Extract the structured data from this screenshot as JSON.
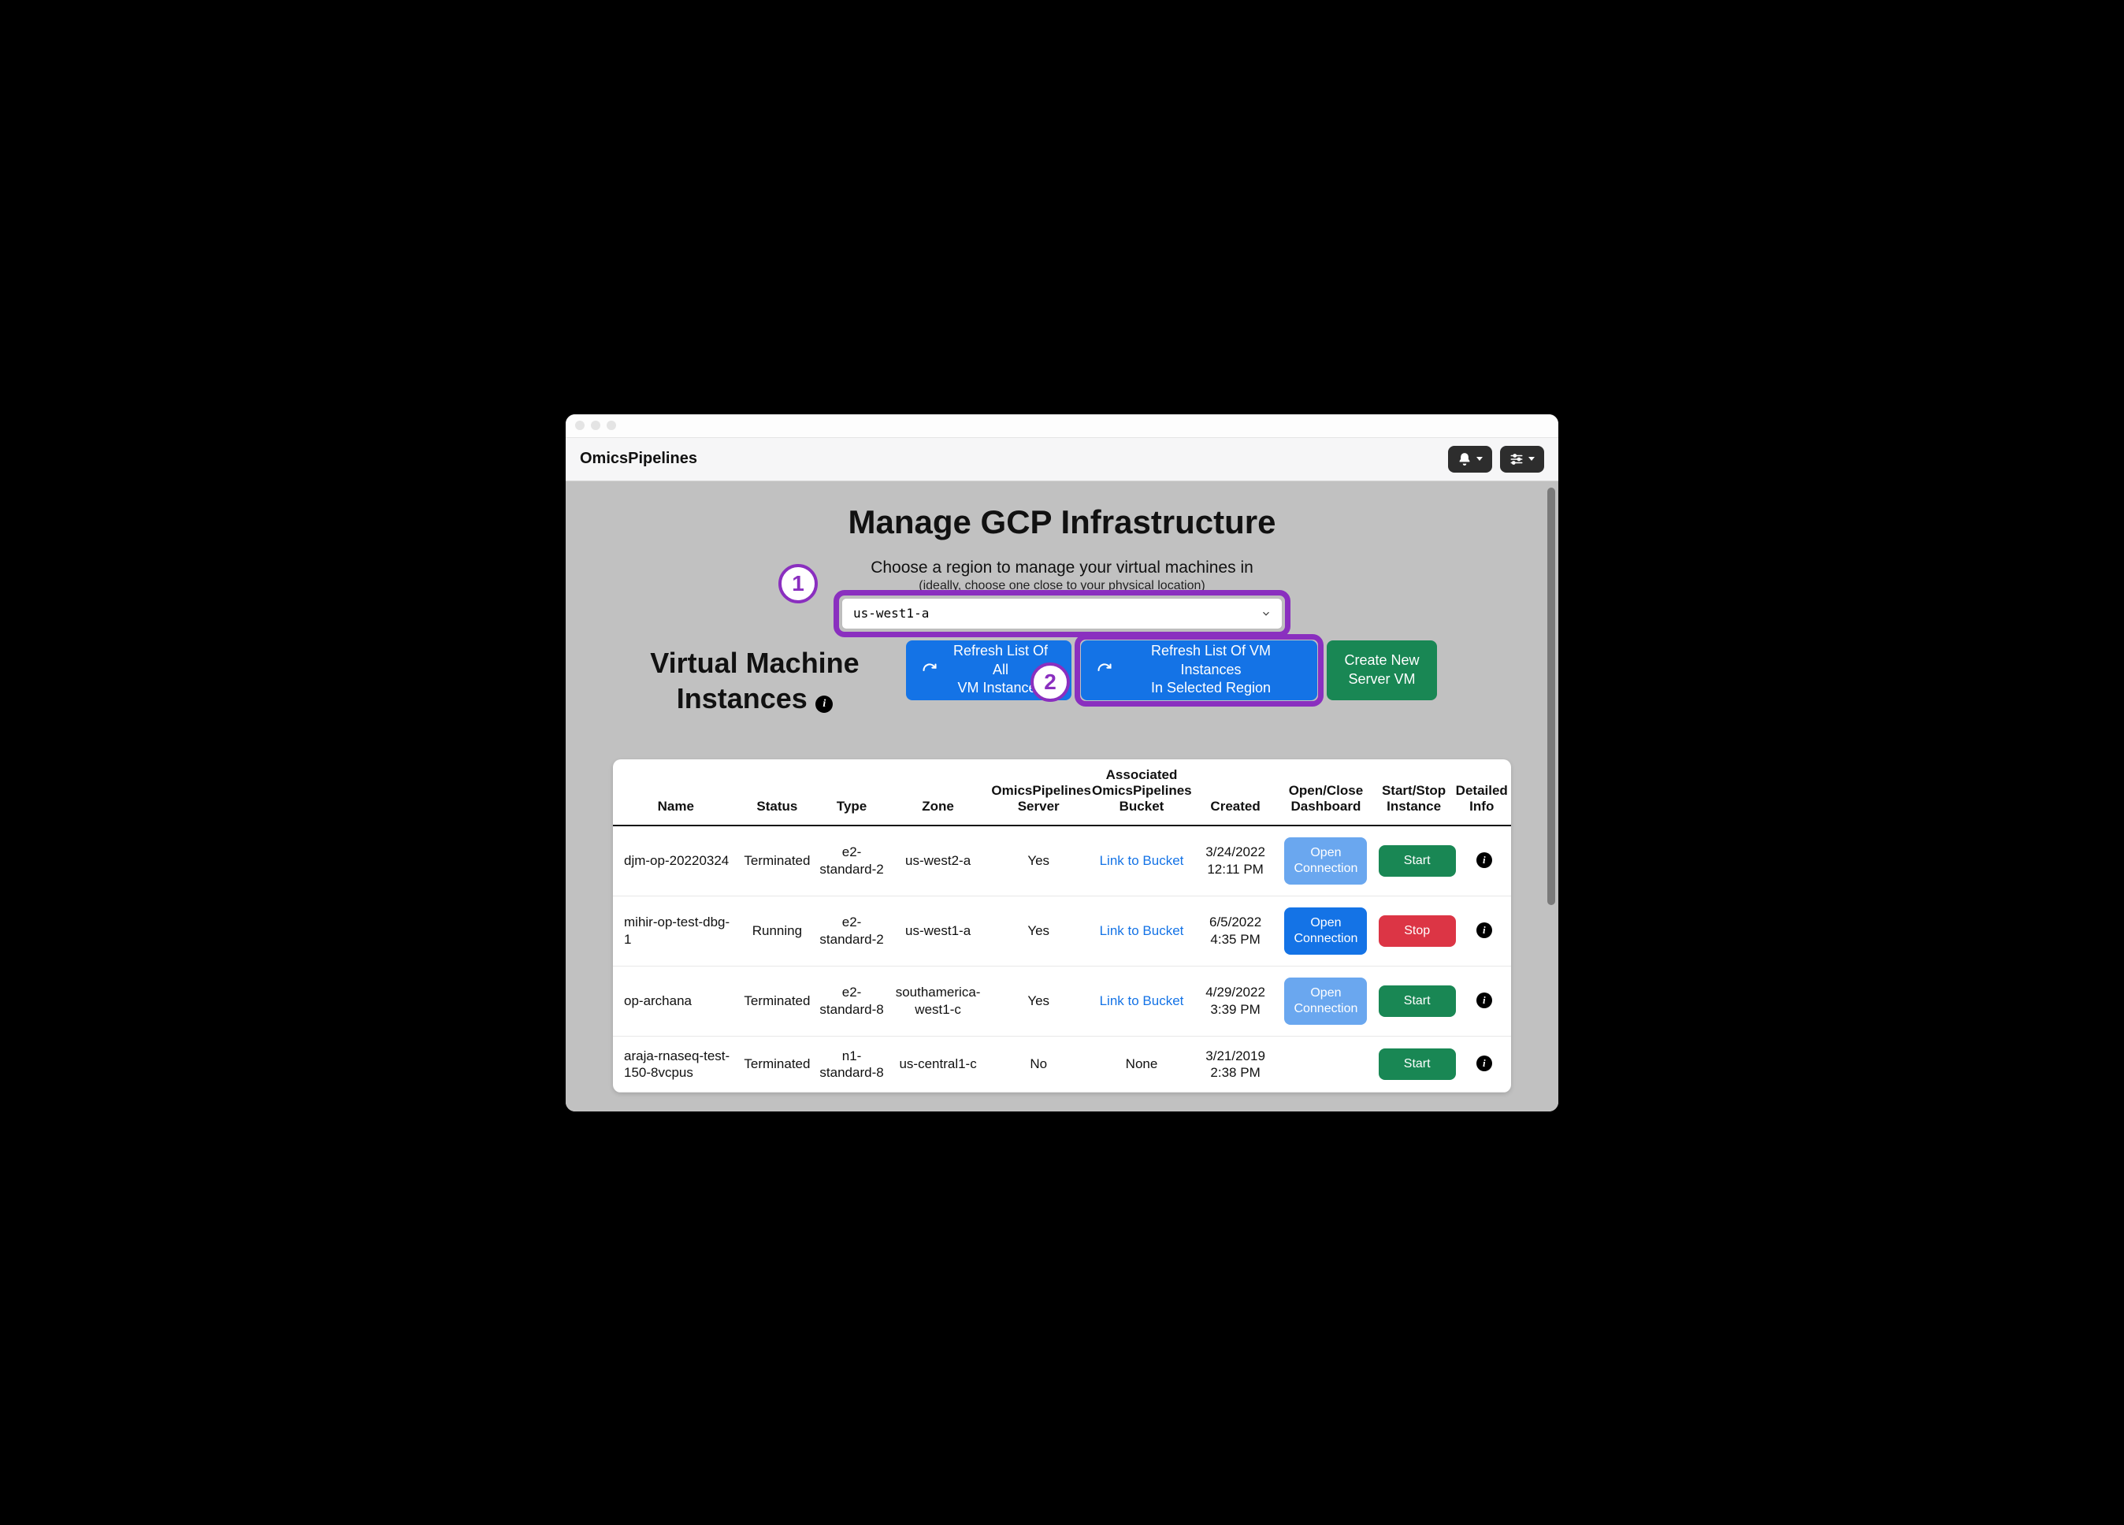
{
  "topbar": {
    "brand": "OmicsPipelines"
  },
  "page": {
    "title": "Manage GCP Infrastructure",
    "region_prompt": "Choose a region to manage your virtual machines in",
    "region_sub": "(ideally, choose one close to your physical location)",
    "region_selected": "us-west1-a",
    "vm_heading_l1": "Virtual Machine",
    "vm_heading_l2": "Instances"
  },
  "annotations": {
    "step1": "1",
    "step2": "2"
  },
  "buttons": {
    "refresh_all_l1": "Refresh List Of All",
    "refresh_all_l2": "VM Instances",
    "refresh_region_l1": "Refresh List Of VM Instances",
    "refresh_region_l2": "In Selected Region",
    "create_vm_l1": "Create New",
    "create_vm_l2": "Server VM",
    "open_connection": "Open Connection",
    "start": "Start",
    "stop": "Stop"
  },
  "table": {
    "headers": {
      "name": "Name",
      "status": "Status",
      "type": "Type",
      "zone": "Zone",
      "server": "OmicsPipelines Server",
      "bucket": "Associated OmicsPipelines Bucket",
      "created": "Created",
      "dashboard": "Open/Close Dashboard",
      "startstop": "Start/Stop Instance",
      "info": "Detailed Info"
    },
    "rows": [
      {
        "name": "djm-op-20220324",
        "status": "Terminated",
        "type": "e2-standard-2",
        "zone": "us-west2-a",
        "server": "Yes",
        "bucket": "Link to Bucket",
        "bucket_is_link": true,
        "created_d": "3/24/2022",
        "created_t": "12:11 PM",
        "dash_enabled": false,
        "ss_action": "start"
      },
      {
        "name": "mihir-op-test-dbg-1",
        "status": "Running",
        "type": "e2-standard-2",
        "zone": "us-west1-a",
        "server": "Yes",
        "bucket": "Link to Bucket",
        "bucket_is_link": true,
        "created_d": "6/5/2022",
        "created_t": "4:35 PM",
        "dash_enabled": true,
        "ss_action": "stop"
      },
      {
        "name": "op-archana",
        "status": "Terminated",
        "type": "e2-standard-8",
        "zone": "southamerica-west1-c",
        "server": "Yes",
        "bucket": "Link to Bucket",
        "bucket_is_link": true,
        "created_d": "4/29/2022",
        "created_t": "3:39 PM",
        "dash_enabled": false,
        "ss_action": "start"
      },
      {
        "name": "araja-rnaseq-test-150-8vcpus",
        "status": "Terminated",
        "type": "n1-standard-8",
        "zone": "us-central1-c",
        "server": "No",
        "bucket": "None",
        "bucket_is_link": false,
        "created_d": "3/21/2019",
        "created_t": "2:38 PM",
        "dash_enabled": null,
        "ss_action": "start"
      }
    ]
  }
}
